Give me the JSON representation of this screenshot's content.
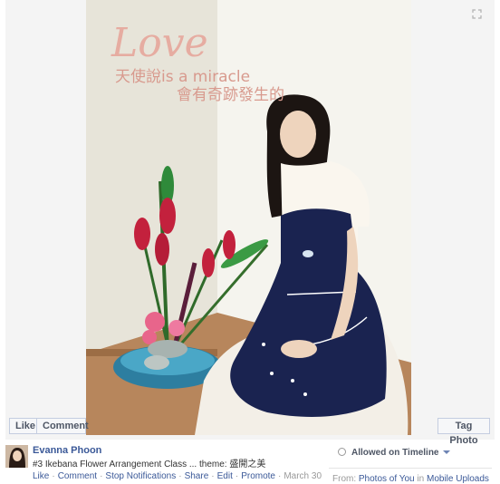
{
  "photo": {
    "overlay_script": "Love",
    "overlay_line1": "天使說is a miracle",
    "overlay_line2": "會有奇跡發生的"
  },
  "photo_actions": {
    "like_label": "Like",
    "comment_label": "Comment",
    "tag_label": "Tag Photo"
  },
  "post": {
    "author": "Evanna Phoon",
    "caption": "#3 Ikebana Flower Arrangement Class ... theme: 盛開之美",
    "actions": [
      {
        "label": "Like"
      },
      {
        "label": "Comment"
      },
      {
        "label": "Stop Notifications"
      },
      {
        "label": "Share"
      },
      {
        "label": "Edit"
      },
      {
        "label": "Promote"
      }
    ],
    "date": "March 30"
  },
  "sidebar": {
    "privacy_label": "Allowed on Timeline",
    "from_prefix": "From:",
    "from_album1": "Photos of You",
    "from_connector": "in",
    "from_album2": "Mobile Uploads"
  },
  "icons": [
    "expand-icon",
    "privacy-dot-icon",
    "dropdown-caret-icon"
  ],
  "colors": {
    "link": "#3b5998",
    "apron": "#1a2350",
    "text": "#333333",
    "muted": "#999999"
  }
}
